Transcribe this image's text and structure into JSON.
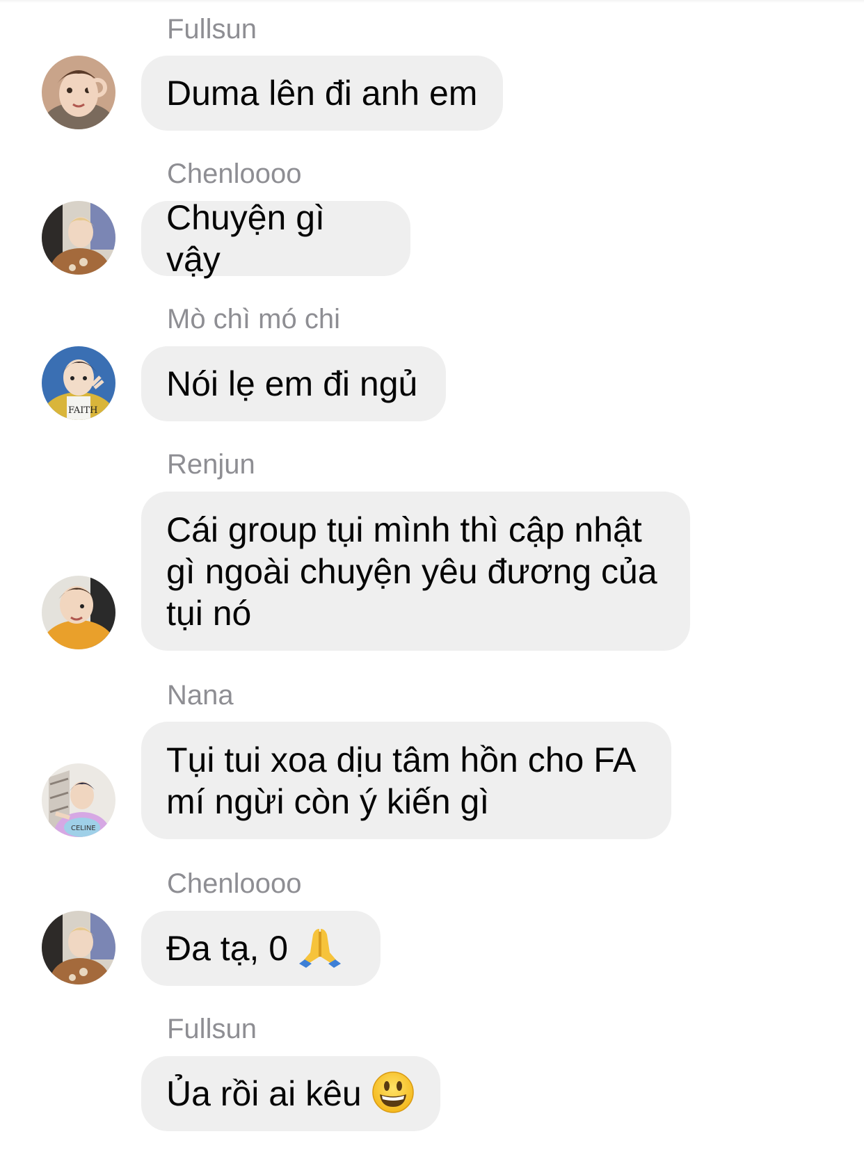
{
  "messages": [
    {
      "sender": "Fullsun",
      "text": "Duma lên đi anh em"
    },
    {
      "sender": "Chenloooo",
      "text": "Chuyện gì vậy"
    },
    {
      "sender": "Mò chì mó chi",
      "text": "Nói lẹ em đi ngủ"
    },
    {
      "sender": "Renjun",
      "text": "Cái group tụi mình thì cập nhật\ngì ngoài chuyện yêu đương của\ntụi nó"
    },
    {
      "sender": "Nana",
      "text": "Tụi tui xoa dịu tâm hồn cho FA\nmí ngừi còn ý kiến gì"
    },
    {
      "sender": "Chenloooo",
      "text": "Đa tạ, 0 ",
      "emoji": "folded-hands-emoji"
    },
    {
      "sender": "Fullsun",
      "text": "Ủa rồi ai kêu ",
      "emoji": "grinning-face-emoji"
    }
  ],
  "colors": {
    "bubble": "#efefef",
    "sender": "#8e8e93",
    "text": "#050505"
  }
}
